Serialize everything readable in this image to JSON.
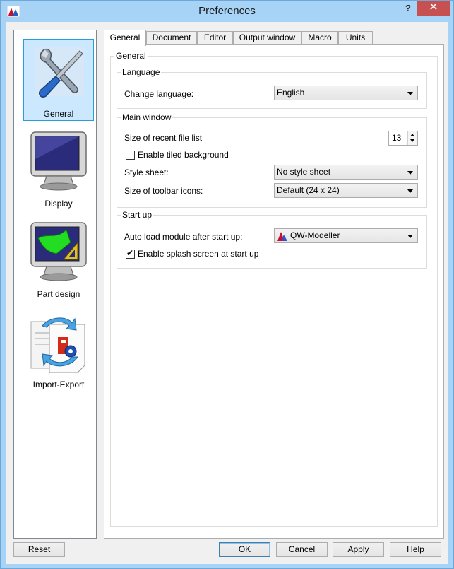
{
  "window": {
    "title": "Preferences",
    "help_glyph": "?",
    "close_glyph": "✕",
    "app_icon": "freecad-icon"
  },
  "pages": [
    {
      "label": "General",
      "icon": "wrench-screwdriver-icon",
      "selected": true
    },
    {
      "label": "Display",
      "icon": "monitor-icon",
      "selected": false
    },
    {
      "label": "Part design",
      "icon": "part-design-monitor-icon",
      "selected": false
    },
    {
      "label": "Import-Export",
      "icon": "import-export-icon",
      "selected": false
    }
  ],
  "tabs": [
    {
      "label": "General",
      "active": true
    },
    {
      "label": "Document",
      "active": false
    },
    {
      "label": "Editor",
      "active": false
    },
    {
      "label": "Output window",
      "active": false
    },
    {
      "label": "Macro",
      "active": false
    },
    {
      "label": "Units",
      "active": false
    }
  ],
  "general": {
    "title": "General",
    "language": {
      "title": "Language",
      "change_language_label": "Change language:",
      "change_language_value": "English"
    },
    "main_window": {
      "title": "Main window",
      "recent_files_label": "Size of recent file list",
      "recent_files_value": "13",
      "tiled_background_label": "Enable tiled background",
      "tiled_background_checked": false,
      "style_sheet_label": "Style sheet:",
      "style_sheet_value": "No style sheet",
      "toolbar_icons_label": "Size of toolbar icons:",
      "toolbar_icons_value": "Default (24 x 24)"
    },
    "start_up": {
      "title": "Start up",
      "autoload_label": "Auto load module after start up:",
      "autoload_value": "QW-Modeller",
      "autoload_icon": "qw-modeller-icon",
      "splash_label": "Enable splash screen at start up",
      "splash_checked": true
    }
  },
  "buttons": {
    "reset": "Reset",
    "ok": "OK",
    "cancel": "Cancel",
    "apply": "Apply",
    "help": "Help"
  },
  "colors": {
    "titlebar": "#a7d3f7",
    "close_button": "#c75050",
    "selection": "#cce8ff"
  }
}
